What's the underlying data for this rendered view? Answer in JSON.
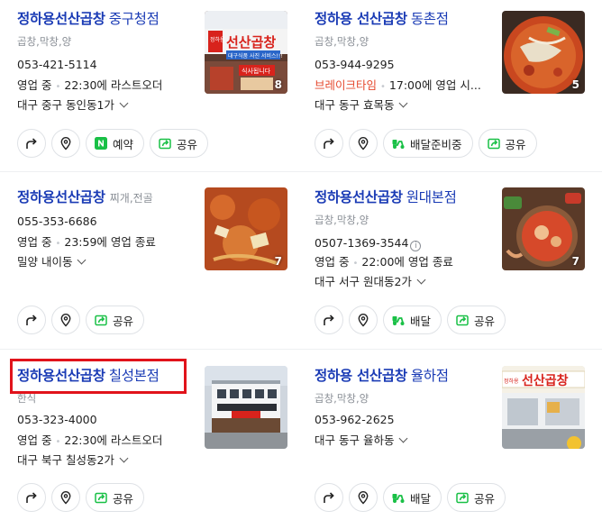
{
  "colors": {
    "title": "#1a3bb5",
    "highlight": "#e1131b",
    "green_icon": "#19c046",
    "break_red": "#e5482d"
  },
  "cards": [
    {
      "name": "정하용선산곱창",
      "branch": "중구청점",
      "category": "곱창,막창,양",
      "phone": "053-421-5114",
      "status_label": "영업 중",
      "status_detail": "22:30에 라스트오더",
      "address": "대구 중구 동인동1가",
      "photo_count": "8",
      "actions": [
        {
          "type": "directions",
          "icon": "directions-icon"
        },
        {
          "type": "place",
          "icon": "map-pin-icon"
        },
        {
          "type": "reserve",
          "icon": "naver-n-icon",
          "label": "예약"
        },
        {
          "type": "share",
          "icon": "share-icon",
          "label": "공유"
        }
      ]
    },
    {
      "name": "정하용 선산곱창",
      "branch": "동촌점",
      "category": "곱창,막창,양",
      "phone": "053-944-9295",
      "status_label": "브레이크타임",
      "status_detail": "17:00에 영업 시...",
      "address": "대구 동구 효목동",
      "photo_count": "5",
      "actions": [
        {
          "type": "directions",
          "icon": "directions-icon"
        },
        {
          "type": "place",
          "icon": "map-pin-icon"
        },
        {
          "type": "delivery",
          "icon": "scooter-icon",
          "label": "배달준비중"
        },
        {
          "type": "share",
          "icon": "share-icon",
          "label": "공유"
        }
      ]
    },
    {
      "name": "정하용선산곱창",
      "branch": "",
      "category": "찌개,전골",
      "phone": "055-353-6686",
      "status_label": "영업 중",
      "status_detail": "23:59에 영업 종료",
      "address": "밀양 내이동",
      "photo_count": "7",
      "actions": [
        {
          "type": "directions",
          "icon": "directions-icon"
        },
        {
          "type": "place",
          "icon": "map-pin-icon"
        },
        {
          "type": "share",
          "icon": "share-icon",
          "label": "공유"
        }
      ]
    },
    {
      "name": "정하용선산곱창",
      "branch": "원대본점",
      "category": "곱창,막창,양",
      "phone": "0507-1369-3544",
      "phone_info_icon": "info-icon",
      "status_label": "영업 중",
      "status_detail": "22:00에 영업 종료",
      "address": "대구 서구 원대동2가",
      "photo_count": "7",
      "actions": [
        {
          "type": "directions",
          "icon": "directions-icon"
        },
        {
          "type": "place",
          "icon": "map-pin-icon"
        },
        {
          "type": "delivery",
          "icon": "scooter-icon",
          "label": "배달"
        },
        {
          "type": "share",
          "icon": "share-icon",
          "label": "공유"
        }
      ]
    },
    {
      "name": "정하용선산곱창",
      "branch": "칠성본점",
      "category": "한식",
      "phone": "053-323-4000",
      "status_label": "영업 중",
      "status_detail": "22:30에 라스트오더",
      "address": "대구 북구 칠성동2가",
      "photo_count": "",
      "actions": [
        {
          "type": "directions",
          "icon": "directions-icon"
        },
        {
          "type": "place",
          "icon": "map-pin-icon"
        },
        {
          "type": "share",
          "icon": "share-icon",
          "label": "공유"
        }
      ]
    },
    {
      "name": "정하용 선산곱창",
      "branch": "율하점",
      "category": "곱창,막창,양",
      "phone": "053-962-2625",
      "status_label": "",
      "status_detail": "",
      "address": "대구 동구 율하동",
      "photo_count": "",
      "actions": [
        {
          "type": "directions",
          "icon": "directions-icon"
        },
        {
          "type": "place",
          "icon": "map-pin-icon"
        },
        {
          "type": "delivery",
          "icon": "scooter-icon",
          "label": "배달"
        },
        {
          "type": "share",
          "icon": "share-icon",
          "label": "공유"
        }
      ]
    }
  ],
  "photo_signs": {
    "card0_sign": "선산곱창",
    "card0_banner1": "대구식품 사진 서비스!!!",
    "card0_banner2": "식사됩니다",
    "card0_side": "정하용",
    "card5_sign": "선산곱창",
    "card5_side": "정하용"
  }
}
